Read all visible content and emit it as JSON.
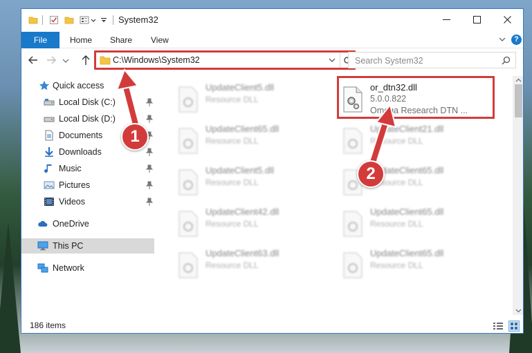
{
  "window": {
    "title": "System32"
  },
  "ribbon": {
    "file_label": "File",
    "home_label": "Home",
    "share_label": "Share",
    "view_label": "View",
    "help_label": "?"
  },
  "address_bar": {
    "path": "C:\\Windows\\System32"
  },
  "search": {
    "placeholder": "Search System32"
  },
  "nav_pane": {
    "items": [
      {
        "label": "Quick access",
        "icon": "star-icon"
      },
      {
        "label": "Local Disk (C:)",
        "icon": "drive-icon",
        "pinned": true
      },
      {
        "label": "Local Disk (D:)",
        "icon": "drive-icon",
        "pinned": true
      },
      {
        "label": "Documents",
        "icon": "document-icon",
        "pinned": true
      },
      {
        "label": "Downloads",
        "icon": "download-icon",
        "pinned": true
      },
      {
        "label": "Music",
        "icon": "music-icon",
        "pinned": true
      },
      {
        "label": "Pictures",
        "icon": "picture-icon",
        "pinned": true
      },
      {
        "label": "Videos",
        "icon": "video-icon",
        "pinned": true
      },
      {
        "label": "OneDrive",
        "icon": "cloud-icon"
      },
      {
        "label": "This PC",
        "icon": "computer-icon",
        "selected": true
      },
      {
        "label": "Network",
        "icon": "network-icon"
      }
    ]
  },
  "files": {
    "highlighted": {
      "name": "or_dtn32.dll",
      "version": "5.0.0.822",
      "description": "Omega Research DTN ..."
    },
    "blurred": [
      {
        "name": "UpdateClient5.dll",
        "sub": "Resource DLL"
      },
      {
        "name": "UpdateClient65.dll",
        "sub": "Resource DLL"
      },
      {
        "name": "UpdateClient21.dll",
        "sub": "Resource DLL"
      },
      {
        "name": "UpdateClient5.dll",
        "sub": "Resource DLL"
      },
      {
        "name": "UpdateClient65.dll",
        "sub": "Resource DLL"
      },
      {
        "name": "UpdateClient42.dll",
        "sub": "Resource DLL"
      },
      {
        "name": "UpdateClient65.dll",
        "sub": "Resource DLL"
      },
      {
        "name": "UpdateClient63.dll",
        "sub": "Resource DLL"
      },
      {
        "name": "UpdateClient65.dll",
        "sub": "Resource DLL"
      }
    ]
  },
  "status": {
    "item_count": "186 items"
  },
  "annotations": {
    "step1": "1",
    "step2": "2"
  },
  "colors": {
    "accent": "#1979ca",
    "highlight": "#d33b3b"
  }
}
